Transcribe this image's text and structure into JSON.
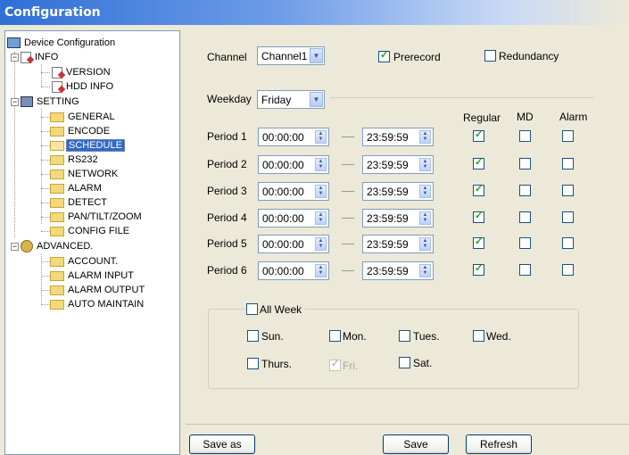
{
  "window": {
    "title": "Configuration"
  },
  "tree": {
    "root": "Device Configuration",
    "info": "INFO",
    "version": "VERSION",
    "hdd_info": "HDD INFO",
    "setting": "SETTING",
    "general": "GENERAL",
    "encode": "ENCODE",
    "schedule": "SCHEDULE",
    "rs232": "RS232",
    "network": "NETWORK",
    "alarm": "ALARM",
    "detect": "DETECT",
    "ptz": "PAN/TILT/ZOOM",
    "config_file": "CONFIG FILE",
    "advanced": "ADVANCED.",
    "account": "ACCOUNT.",
    "alarm_input": "ALARM INPUT",
    "alarm_output": "ALARM OUTPUT",
    "auto_maintain": "AUTO MAINTAIN"
  },
  "channel": {
    "label": "Channel",
    "value": "Channel1"
  },
  "prerecord": {
    "label": "Prerecord",
    "checked": true
  },
  "redundancy": {
    "label": "Redundancy",
    "checked": false
  },
  "weekday": {
    "label": "Weekday",
    "value": "Friday"
  },
  "columns": {
    "regular": "Regular",
    "md": "MD",
    "alarm": "Alarm"
  },
  "periods": [
    {
      "label": "Period 1",
      "start": "00:00:00",
      "end": "23:59:59",
      "regular": true,
      "md": false,
      "alarm": false
    },
    {
      "label": "Period 2",
      "start": "00:00:00",
      "end": "23:59:59",
      "regular": true,
      "md": false,
      "alarm": false
    },
    {
      "label": "Period 3",
      "start": "00:00:00",
      "end": "23:59:59",
      "regular": true,
      "md": false,
      "alarm": false
    },
    {
      "label": "Period 4",
      "start": "00:00:00",
      "end": "23:59:59",
      "regular": true,
      "md": false,
      "alarm": false
    },
    {
      "label": "Period 5",
      "start": "00:00:00",
      "end": "23:59:59",
      "regular": true,
      "md": false,
      "alarm": false
    },
    {
      "label": "Period 6",
      "start": "00:00:00",
      "end": "23:59:59",
      "regular": true,
      "md": false,
      "alarm": false
    }
  ],
  "copy_days": {
    "all_week": "All Week",
    "sun": "Sun.",
    "mon": "Mon.",
    "tues": "Tues.",
    "wed": "Wed.",
    "thurs": "Thurs.",
    "fri": "Fri.",
    "sat": "Sat."
  },
  "buttons": {
    "save_as": "Save as",
    "save": "Save",
    "refresh": "Refresh"
  }
}
